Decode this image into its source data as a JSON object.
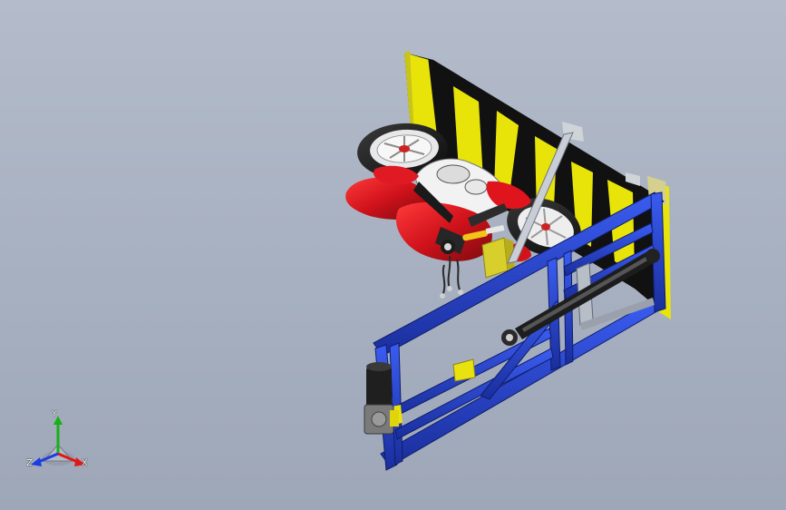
{
  "viewport": {
    "background_top": "#b4bccb",
    "background_bottom": "#9ea7b8"
  },
  "model": {
    "frame_color": "#2440c8",
    "wall_yellow": "#e8e40a",
    "wall_black": "#111111",
    "bike_red": "#d0121b",
    "plate_yellow": "#d8cf2c"
  },
  "triad": {
    "icon": "coordinate-triad-icon",
    "x_label": "X",
    "y_label": "Y",
    "z_label": "Z",
    "x_color": "#e01818",
    "y_color": "#18b018",
    "z_color": "#1a3ee0"
  }
}
